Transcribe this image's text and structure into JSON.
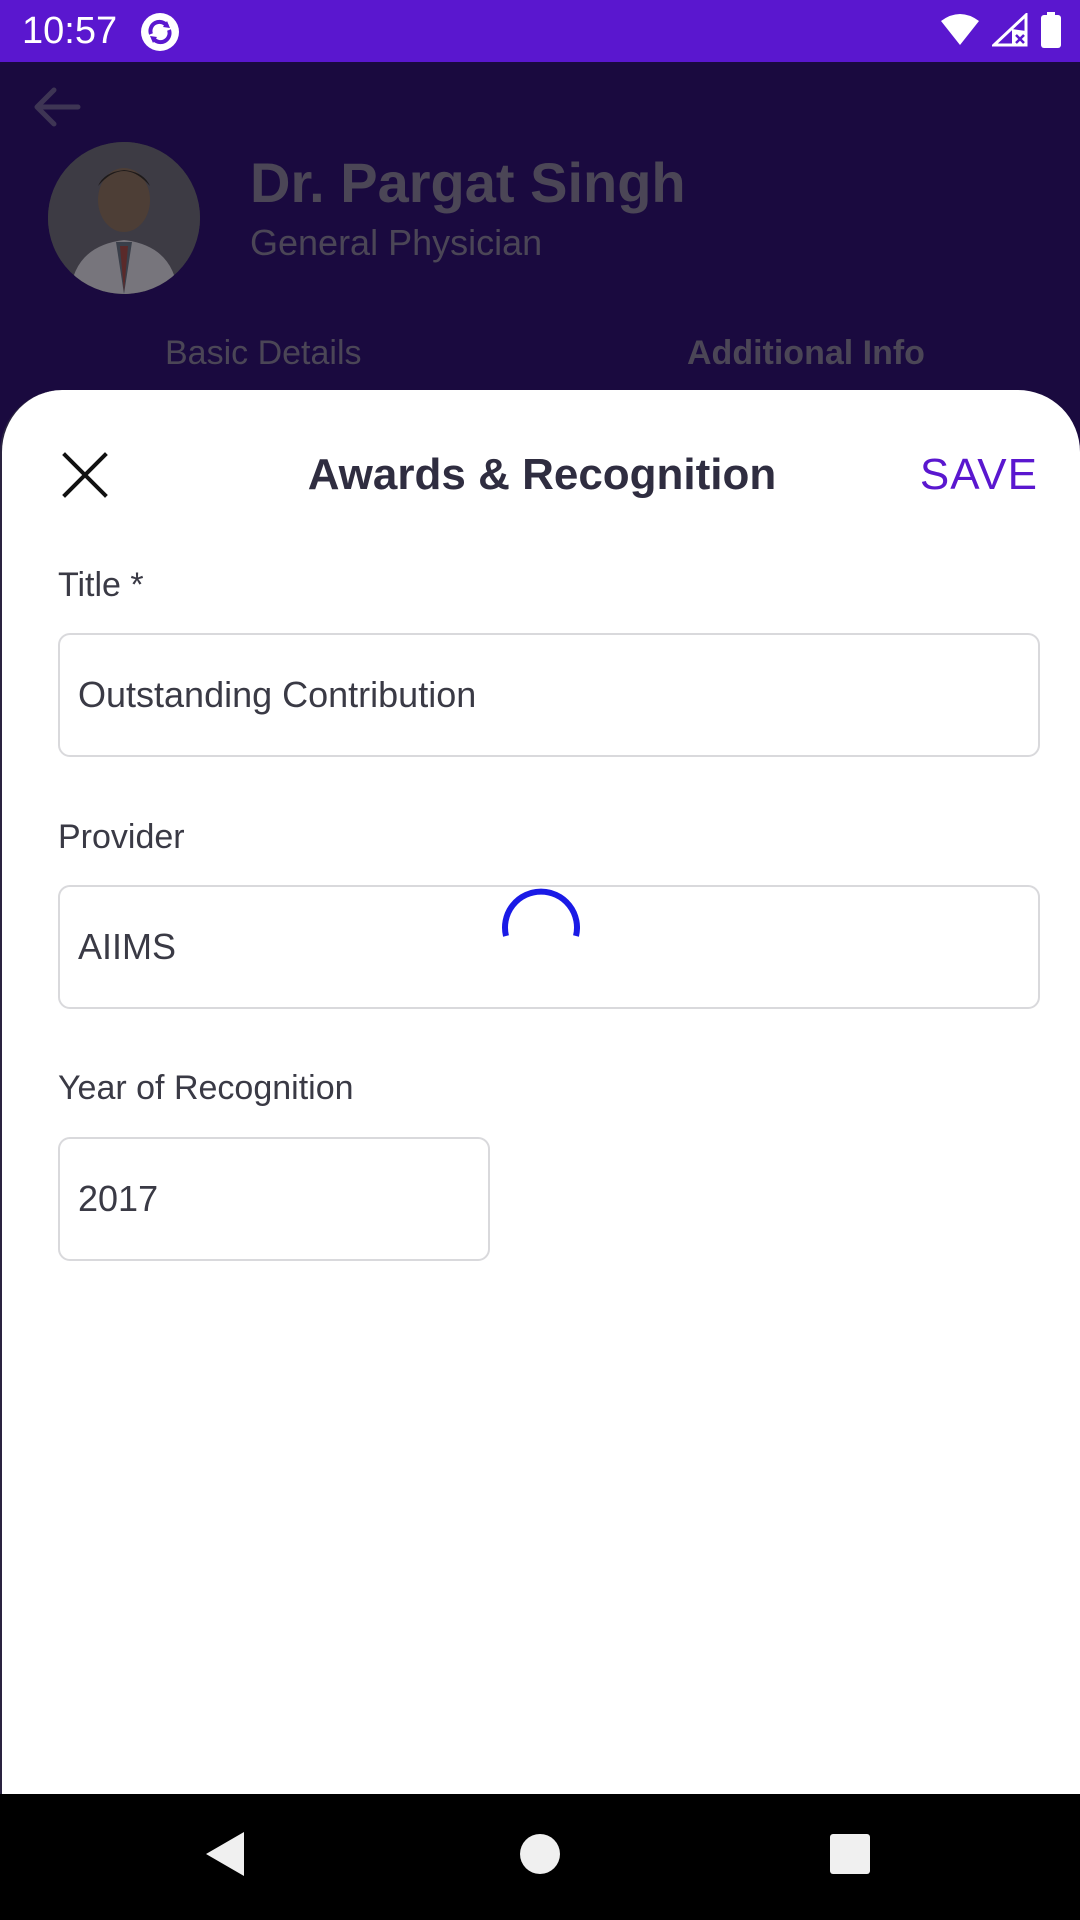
{
  "status_bar": {
    "time": "10:57",
    "app_icon": "sync-app-icon",
    "icons": [
      "wifi-icon",
      "signal-icon",
      "battery-icon"
    ]
  },
  "profile": {
    "name": "Dr. Pargat Singh",
    "specialty": "General Physician",
    "tabs": [
      {
        "label": "Basic Details"
      },
      {
        "label": "Additional Info"
      }
    ]
  },
  "sheet": {
    "title": "Awards & Recognition",
    "save_label": "SAVE",
    "fields": {
      "title": {
        "label": "Title *",
        "value": "Outstanding Contribution"
      },
      "provider": {
        "label": "Provider",
        "value": "AIIMS"
      },
      "year": {
        "label": "Year of Recognition",
        "value": "2017"
      }
    }
  },
  "colors": {
    "accent": "#5a17cf",
    "spinner": "#1a1ae6",
    "overlay": "#1a0a3f"
  },
  "nav_bar": {
    "icons": [
      "back-triangle-icon",
      "home-circle-icon",
      "recents-square-icon"
    ]
  }
}
